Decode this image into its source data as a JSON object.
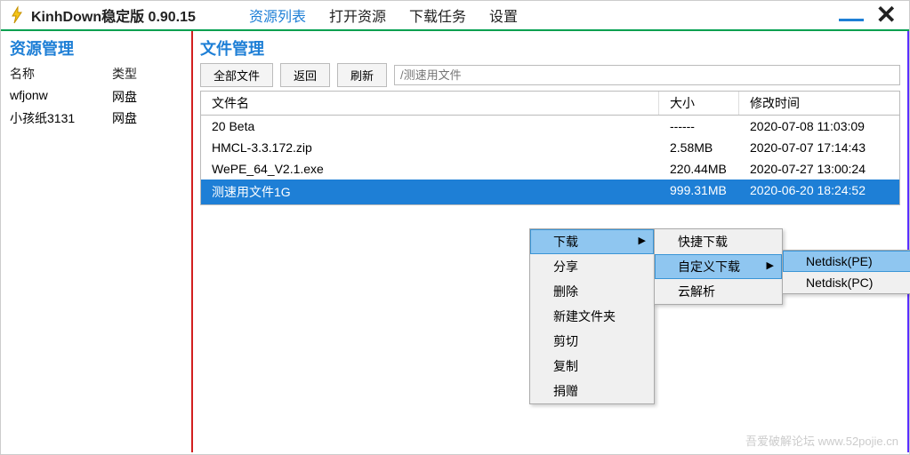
{
  "app": {
    "title": "KinhDown稳定版 0.90.15"
  },
  "nav": {
    "items": [
      "资源列表",
      "打开资源",
      "下载任务",
      "设置"
    ],
    "active": 0
  },
  "sidebar": {
    "title": "资源管理",
    "headers": {
      "name": "名称",
      "type": "类型"
    },
    "rows": [
      {
        "name": "wfjonw",
        "type": "网盘"
      },
      {
        "name": "小孩纸3131",
        "type": "网盘"
      }
    ]
  },
  "main": {
    "title": "文件管理",
    "toolbar": {
      "all": "全部文件",
      "back": "返回",
      "refresh": "刷新"
    },
    "path_placeholder": "/测速用文件",
    "headers": {
      "name": "文件名",
      "size": "大小",
      "time": "修改时间"
    },
    "rows": [
      {
        "name": "20 Beta",
        "size": "------",
        "time": "2020-07-08 11:03:09"
      },
      {
        "name": "HMCL-3.3.172.zip",
        "size": "2.58MB",
        "time": "2020-07-07 17:14:43"
      },
      {
        "name": "WePE_64_V2.1.exe",
        "size": "220.44MB",
        "time": "2020-07-27 13:00:24"
      },
      {
        "name": "测速用文件1G",
        "size": "999.31MB",
        "time": "2020-06-20 18:24:52"
      }
    ],
    "selected": 3
  },
  "context_menu": {
    "level1": [
      {
        "label": "下载",
        "submenu": true
      },
      {
        "label": "分享"
      },
      {
        "label": "删除"
      },
      {
        "label": "新建文件夹"
      },
      {
        "label": "剪切"
      },
      {
        "label": "复制"
      },
      {
        "label": "捐赠"
      }
    ],
    "level2": [
      {
        "label": "快捷下载"
      },
      {
        "label": "自定义下载",
        "submenu": true
      },
      {
        "label": "云解析"
      }
    ],
    "level3": [
      {
        "label": "Netdisk(PE)"
      },
      {
        "label": "Netdisk(PC)"
      }
    ]
  },
  "watermark": "吾爱破解论坛 www.52pojie.cn"
}
